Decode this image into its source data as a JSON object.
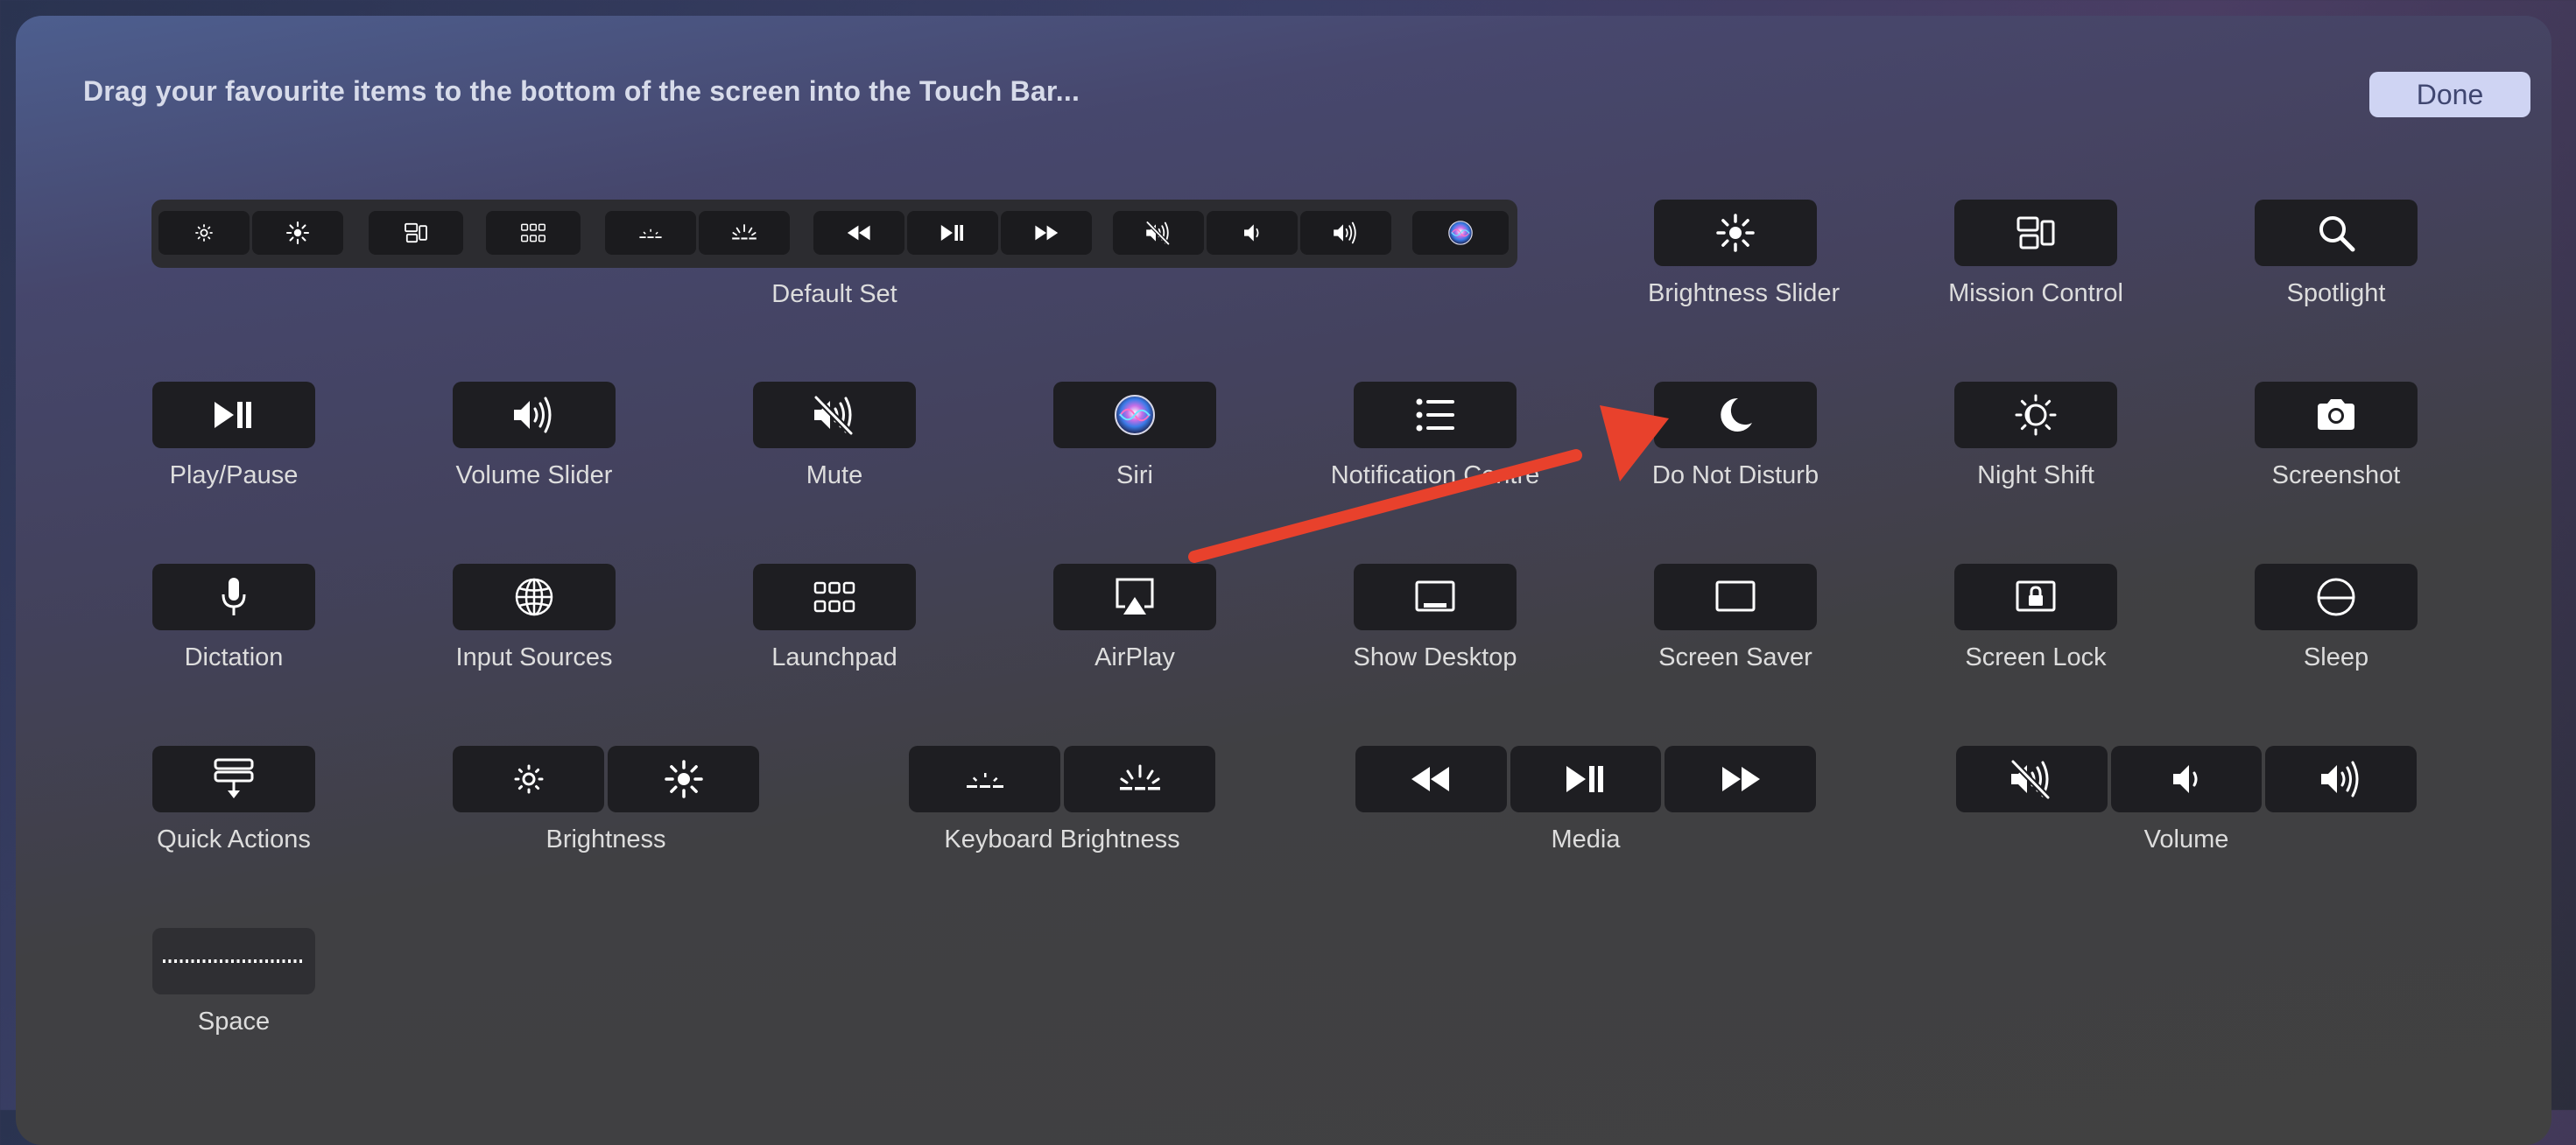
{
  "header": {
    "instruction": "Drag your favourite items to the bottom of the screen into the Touch Bar...",
    "done_label": "Done"
  },
  "default_set": {
    "label": "Default Set",
    "icons": [
      "brightness-down-icon",
      "brightness-up-icon",
      "mission-control-icon",
      "launchpad-icon",
      "keyboard-brightness-down-icon",
      "keyboard-brightness-up-icon",
      "rewind-icon",
      "play-pause-icon",
      "fast-forward-icon",
      "mute-icon",
      "volume-down-icon",
      "volume-up-icon",
      "siri-icon"
    ]
  },
  "items": {
    "brightness_slider": "Brightness Slider",
    "mission_control": "Mission Control",
    "spotlight": "Spotlight",
    "play_pause": "Play/Pause",
    "volume_slider": "Volume Slider",
    "mute": "Mute",
    "siri": "Siri",
    "notification_centre": "Notification Centre",
    "do_not_disturb": "Do Not Disturb",
    "night_shift": "Night Shift",
    "screenshot": "Screenshot",
    "dictation": "Dictation",
    "input_sources": "Input Sources",
    "launchpad": "Launchpad",
    "airplay": "AirPlay",
    "show_desktop": "Show Desktop",
    "screen_saver": "Screen Saver",
    "screen_lock": "Screen Lock",
    "sleep": "Sleep",
    "quick_actions": "Quick Actions",
    "brightness": "Brightness",
    "keyboard_brightness": "Keyboard Brightness",
    "media": "Media",
    "volume": "Volume",
    "space": "Space"
  },
  "colors": {
    "annotation_arrow": "#e8412c",
    "done_button": "#cfd4f3",
    "key_background": "#1e1e22"
  }
}
